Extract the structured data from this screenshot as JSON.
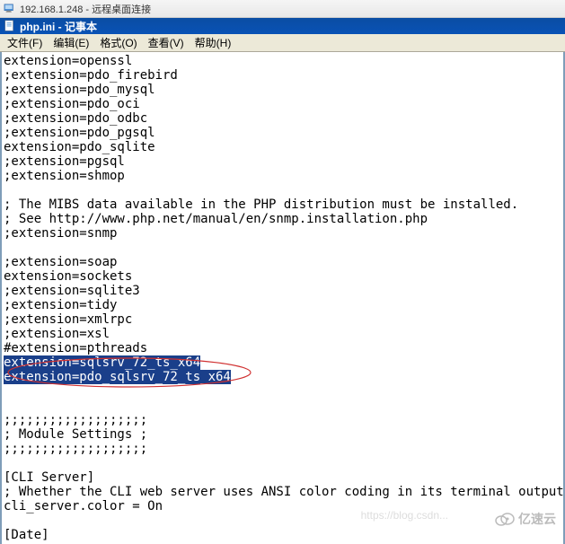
{
  "rdp": {
    "title": "192.168.1.248 - 远程桌面连接"
  },
  "notepad": {
    "title": "php.ini - 记事本"
  },
  "menu": {
    "file": "文件(F)",
    "edit": "编辑(E)",
    "format": "格式(O)",
    "view": "查看(V)",
    "help": "帮助(H)"
  },
  "content": {
    "lines_before": "extension=openssl\n;extension=pdo_firebird\n;extension=pdo_mysql\n;extension=pdo_oci\n;extension=pdo_odbc\n;extension=pdo_pgsql\nextension=pdo_sqlite\n;extension=pgsql\n;extension=shmop\n\n; The MIBS data available in the PHP distribution must be installed.\n; See http://www.php.net/manual/en/snmp.installation.php\n;extension=snmp\n\n;extension=soap\nextension=sockets\n;extension=sqlite3\n;extension=tidy\n;extension=xmlrpc\n;extension=xsl\n#extension=pthreads",
    "highlighted1": "extension=sqlsrv_72_ts_x64",
    "highlighted2": "extension=pdo_sqlsrv_72_ts_x64",
    "lines_after": "\n\n;;;;;;;;;;;;;;;;;;;\n; Module Settings ;\n;;;;;;;;;;;;;;;;;;;\n\n[CLI Server]\n; Whether the CLI web server uses ANSI color coding in its terminal output.\ncli_server.color = On\n\n[Date]"
  },
  "watermark": {
    "csdn": "https://blog.csdn...",
    "yisu": "亿速云"
  }
}
